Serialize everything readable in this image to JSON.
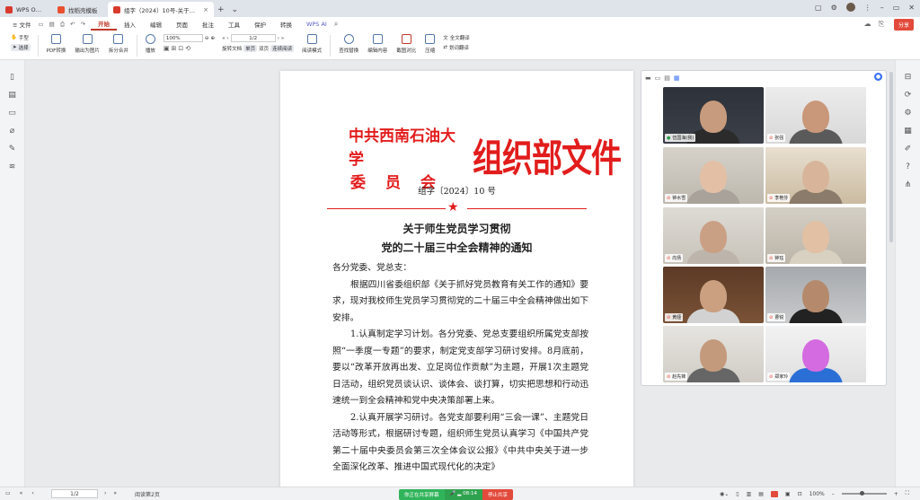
{
  "titlebar": {
    "tabs": [
      {
        "label": "WPS Office",
        "color": "#d83b2e"
      },
      {
        "label": "找稻壳模板",
        "color": "#e8502f"
      },
      {
        "label": "组字（2024）10号-关于师生党",
        "color": "#d83b2e"
      }
    ],
    "plus": "+",
    "dropdown": "⌄"
  },
  "menubar": {
    "file": "≡ 文件",
    "items": [
      "开始",
      "插入",
      "编辑",
      "页面",
      "批注",
      "工具",
      "保护",
      "转换"
    ],
    "active_index": 0,
    "wps_ai": "WPS AI",
    "share": "分享"
  },
  "ribbon": {
    "hand": "手型",
    "select": "选择",
    "pdf_convert": "PDF转换",
    "export_image": "输出为图片",
    "split_merge": "拆分合并",
    "play": "播放",
    "zoom": "100%",
    "page": "1/2",
    "rotate": "旋转文档",
    "single_page": "单页",
    "double_page": "双页",
    "continuous": "连续阅读",
    "read_mode": "阅读模式",
    "find": "查找替换",
    "edit_content": "编辑内容",
    "screenshot_compare": "截图对比",
    "compress": "压缩",
    "full_translate": "全文翻译",
    "word_translate": "划词翻译"
  },
  "document": {
    "head_left_line1": "中共西南石油大学",
    "head_left_line2": "委员会",
    "head_right": "组织部文件",
    "doc_no": "组字〔2024〕10 号",
    "star": "★",
    "title_line1": "关于师生党员学习贯彻",
    "title_line2": "党的二十届三中全会精神的通知",
    "salutation": "各分党委、党总支：",
    "para1": "根据四川省委组织部《关于抓好党员教育有关工作的通知》要求，现对我校师生党员学习贯彻党的二十届三中全会精神做出如下安排。",
    "para2": "1.认真制定学习计划。各分党委、党总支要组织所属党支部按照“一季度一专题”的要求，制定党支部学习研讨安排。8月底前，要以“改革开放再出发、立足岗位作贡献”为主题，开展1次主题党日活动，组织党员谈认识、谈体会、谈打算，切实把思想和行动迅速统一到全会精神和党中央决策部署上来。",
    "para3": "2.认真开展学习研讨。各党支部要利用“三会一课”、主题党日活动等形式，根据研讨专题，组织师生党员认真学习《中国共产党第二十届中央委员会第三次全体会议公报》《中共中央关于进一步全面深化改革、推进中国式现代化的决定》"
  },
  "video_panel": {
    "participants": [
      {
        "name": "伍国海(我)",
        "mic_on": true
      },
      {
        "name": "张强",
        "mic_on": false
      },
      {
        "name": "钟水雪",
        "mic_on": false
      },
      {
        "name": "李艳芬",
        "mic_on": false
      },
      {
        "name": "向扬",
        "mic_on": false
      },
      {
        "name": "钟珏",
        "mic_on": false
      },
      {
        "name": "黄娅",
        "mic_on": false
      },
      {
        "name": "曹锐",
        "mic_on": false
      },
      {
        "name": "赵先锋",
        "mic_on": false
      },
      {
        "name": "郑家玲",
        "mic_on": false
      }
    ]
  },
  "statusbar": {
    "page": "1/2",
    "info": "阅读第2页",
    "sharing": "你正在共享屏幕",
    "timer": "08:14",
    "stop_share": "停止共享",
    "zoom": "100%"
  }
}
